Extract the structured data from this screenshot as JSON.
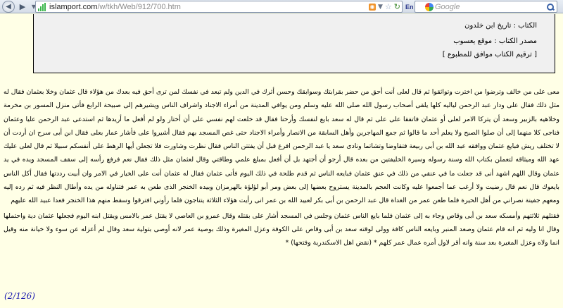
{
  "browser": {
    "url_host": "islamport.com",
    "url_path": "/w/tkh/Web/912/700.htm",
    "language_badge": "En",
    "search_placeholder": "Google"
  },
  "info": {
    "book": "الكتاب : تاريخ ابن خلدون",
    "source": "مصدر الكتاب : موقع يعسوب",
    "numbering": "[ ترقيم الكتاب موافق للمطبوع ]"
  },
  "content": {
    "paragraph_1": "معى على من خالف وترضوا من اخترت وتواثقوا ثم قال لعلى أنت أحق من حضر بقرابتك وسوابقك وحسن أثرك في الدين ولم تبعد في نفسك لمن ترى أحق فيه بعدك من هؤلاء قال عثمان وخلا بعثمان فقال له مثل ذلك فقال على ودار عبد الرحمن لياليه كلها يلقى أصحاب رسول الله صلى الله عليه وسلم ومن يوافي المدينة من أمراء الاجناد واشراف الناس ويشيرهم إلى صبيحة الرابع فأتى منزل المسور بن مخرمة وخلاهيه بالزبير وسعد أن يتركا الامر لعلى أو عثمان فاتفقا على على ثم قال له سعد بايع لنفسك وأرحنا فقال قد خلعت لهم نفسي على أن أختار ولو لم أفعل ما أريدها ثم استدعى عبد الرحمن عليا وعثمان فناجى كلا منهما إلى أن صلوا الصبح ولا يعلم أحد ما قالوا ثم جمع المهاجرين وأهل السابقة من الانصار وأمراء الاجناد حتى غص المسجد بهم فقال أشيروا على فأشار عمار بعلى فقال ابن أبى سرح ان أردت أن لا تختلف ريش فبايع عثمان ووافقه عبد الله بن أبى ربيعة فتقاوضا وتشاتما ونادى سعد يا عبد الرحمن افرغ قبل أن يفتتن الناس فقال نظرت وشاورت فلا تجعلن أيها الرهط على أنفسكم سبيلا ثم قال لعلى عليك عهد الله وميثاقه لتعملن بكتاب الله وسنة رسوله وسيرة الخليفتين من بعده قال أرجو أن أجتهد بل أن أفعل بمبلغ علمي وطاقتي وقال لعثمان مثل ذلك فقال نعم فرفع رأسه إلى سقف المسجد ويده في يد عثمان وقال اللهم اشهد أنى قد جعلت ما في عنقي من ذلك في عنق عثمان فبايعه الناس ثم قدم طلحة في ذلك اليوم فأتى عثمان فقال له عثمان أنت على الخيار في الامر وان أبيت رددتها فقال أكل الناس بايعوك قال نعم قال رضيت ولا أرغب عما أجمعوا عليه وكانت العجم بالمدينة يستروح بعضها إلى بعض ومر أبو لؤلؤة بالهرمزان وبيده الخنجر الذى طعن به عمر فتناوله من يده وأطال النظر فيه ثم رده إليه ومعهم جفينة نصراني من أهل الحيرة فلما طعن عمر من الغداة قال عبد الرحمن بن أبى بكر لعبيد الله بن عمر انى رأيت هؤلاء الثلاثة يتناجون فلما رأوني افترقوا وسقط منهم هذا الخنجر فعدا عبيد الله عليهم",
    "paragraph_2": "فقتلهم ثلاثتهم وأمسكه سعد بن أبى وقاص وجاء به إلى عثمان فلما بايع الناس عثمان وجلس في المسجد أشار على بقتله وقال عمرو بن العاصي لا يقتل عمر بالامس ويقتل ابنه اليوم فجعلها عثمان دية واحتملها وقال انا وليه ثم انه قام عثمان وصعد المنبر وبايعه الناس كافة وولى لوقته سعد بن أبى وقاص على الكوفة وعزل المغيرة وذلك بوصية عمر لانه أوصى بتولية سعد وقال لم أعزله عن سوء ولا خيانة منه وقيل انما ولاه وعزل المغيرة بعد سنة وانه أقر لاول أمره عمال عمر كلهم * (نقض اهل الاسكندرية وفتحها) *"
  },
  "page_number": "(2/126)"
}
